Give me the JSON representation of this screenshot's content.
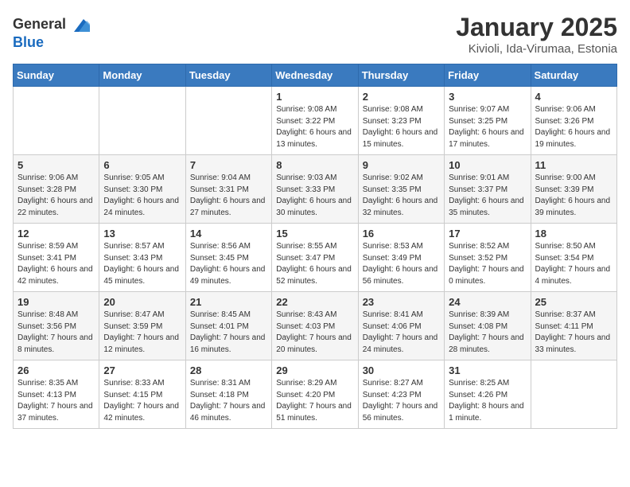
{
  "header": {
    "logo_general": "General",
    "logo_blue": "Blue",
    "title": "January 2025",
    "subtitle": "Kivioli, Ida-Virumaa, Estonia"
  },
  "weekdays": [
    "Sunday",
    "Monday",
    "Tuesday",
    "Wednesday",
    "Thursday",
    "Friday",
    "Saturday"
  ],
  "weeks": [
    [
      {
        "day": "",
        "sunrise": "",
        "sunset": "",
        "daylight": ""
      },
      {
        "day": "",
        "sunrise": "",
        "sunset": "",
        "daylight": ""
      },
      {
        "day": "",
        "sunrise": "",
        "sunset": "",
        "daylight": ""
      },
      {
        "day": "1",
        "sunrise": "Sunrise: 9:08 AM",
        "sunset": "Sunset: 3:22 PM",
        "daylight": "Daylight: 6 hours and 13 minutes."
      },
      {
        "day": "2",
        "sunrise": "Sunrise: 9:08 AM",
        "sunset": "Sunset: 3:23 PM",
        "daylight": "Daylight: 6 hours and 15 minutes."
      },
      {
        "day": "3",
        "sunrise": "Sunrise: 9:07 AM",
        "sunset": "Sunset: 3:25 PM",
        "daylight": "Daylight: 6 hours and 17 minutes."
      },
      {
        "day": "4",
        "sunrise": "Sunrise: 9:06 AM",
        "sunset": "Sunset: 3:26 PM",
        "daylight": "Daylight: 6 hours and 19 minutes."
      }
    ],
    [
      {
        "day": "5",
        "sunrise": "Sunrise: 9:06 AM",
        "sunset": "Sunset: 3:28 PM",
        "daylight": "Daylight: 6 hours and 22 minutes."
      },
      {
        "day": "6",
        "sunrise": "Sunrise: 9:05 AM",
        "sunset": "Sunset: 3:30 PM",
        "daylight": "Daylight: 6 hours and 24 minutes."
      },
      {
        "day": "7",
        "sunrise": "Sunrise: 9:04 AM",
        "sunset": "Sunset: 3:31 PM",
        "daylight": "Daylight: 6 hours and 27 minutes."
      },
      {
        "day": "8",
        "sunrise": "Sunrise: 9:03 AM",
        "sunset": "Sunset: 3:33 PM",
        "daylight": "Daylight: 6 hours and 30 minutes."
      },
      {
        "day": "9",
        "sunrise": "Sunrise: 9:02 AM",
        "sunset": "Sunset: 3:35 PM",
        "daylight": "Daylight: 6 hours and 32 minutes."
      },
      {
        "day": "10",
        "sunrise": "Sunrise: 9:01 AM",
        "sunset": "Sunset: 3:37 PM",
        "daylight": "Daylight: 6 hours and 35 minutes."
      },
      {
        "day": "11",
        "sunrise": "Sunrise: 9:00 AM",
        "sunset": "Sunset: 3:39 PM",
        "daylight": "Daylight: 6 hours and 39 minutes."
      }
    ],
    [
      {
        "day": "12",
        "sunrise": "Sunrise: 8:59 AM",
        "sunset": "Sunset: 3:41 PM",
        "daylight": "Daylight: 6 hours and 42 minutes."
      },
      {
        "day": "13",
        "sunrise": "Sunrise: 8:57 AM",
        "sunset": "Sunset: 3:43 PM",
        "daylight": "Daylight: 6 hours and 45 minutes."
      },
      {
        "day": "14",
        "sunrise": "Sunrise: 8:56 AM",
        "sunset": "Sunset: 3:45 PM",
        "daylight": "Daylight: 6 hours and 49 minutes."
      },
      {
        "day": "15",
        "sunrise": "Sunrise: 8:55 AM",
        "sunset": "Sunset: 3:47 PM",
        "daylight": "Daylight: 6 hours and 52 minutes."
      },
      {
        "day": "16",
        "sunrise": "Sunrise: 8:53 AM",
        "sunset": "Sunset: 3:49 PM",
        "daylight": "Daylight: 6 hours and 56 minutes."
      },
      {
        "day": "17",
        "sunrise": "Sunrise: 8:52 AM",
        "sunset": "Sunset: 3:52 PM",
        "daylight": "Daylight: 7 hours and 0 minutes."
      },
      {
        "day": "18",
        "sunrise": "Sunrise: 8:50 AM",
        "sunset": "Sunset: 3:54 PM",
        "daylight": "Daylight: 7 hours and 4 minutes."
      }
    ],
    [
      {
        "day": "19",
        "sunrise": "Sunrise: 8:48 AM",
        "sunset": "Sunset: 3:56 PM",
        "daylight": "Daylight: 7 hours and 8 minutes."
      },
      {
        "day": "20",
        "sunrise": "Sunrise: 8:47 AM",
        "sunset": "Sunset: 3:59 PM",
        "daylight": "Daylight: 7 hours and 12 minutes."
      },
      {
        "day": "21",
        "sunrise": "Sunrise: 8:45 AM",
        "sunset": "Sunset: 4:01 PM",
        "daylight": "Daylight: 7 hours and 16 minutes."
      },
      {
        "day": "22",
        "sunrise": "Sunrise: 8:43 AM",
        "sunset": "Sunset: 4:03 PM",
        "daylight": "Daylight: 7 hours and 20 minutes."
      },
      {
        "day": "23",
        "sunrise": "Sunrise: 8:41 AM",
        "sunset": "Sunset: 4:06 PM",
        "daylight": "Daylight: 7 hours and 24 minutes."
      },
      {
        "day": "24",
        "sunrise": "Sunrise: 8:39 AM",
        "sunset": "Sunset: 4:08 PM",
        "daylight": "Daylight: 7 hours and 28 minutes."
      },
      {
        "day": "25",
        "sunrise": "Sunrise: 8:37 AM",
        "sunset": "Sunset: 4:11 PM",
        "daylight": "Daylight: 7 hours and 33 minutes."
      }
    ],
    [
      {
        "day": "26",
        "sunrise": "Sunrise: 8:35 AM",
        "sunset": "Sunset: 4:13 PM",
        "daylight": "Daylight: 7 hours and 37 minutes."
      },
      {
        "day": "27",
        "sunrise": "Sunrise: 8:33 AM",
        "sunset": "Sunset: 4:15 PM",
        "daylight": "Daylight: 7 hours and 42 minutes."
      },
      {
        "day": "28",
        "sunrise": "Sunrise: 8:31 AM",
        "sunset": "Sunset: 4:18 PM",
        "daylight": "Daylight: 7 hours and 46 minutes."
      },
      {
        "day": "29",
        "sunrise": "Sunrise: 8:29 AM",
        "sunset": "Sunset: 4:20 PM",
        "daylight": "Daylight: 7 hours and 51 minutes."
      },
      {
        "day": "30",
        "sunrise": "Sunrise: 8:27 AM",
        "sunset": "Sunset: 4:23 PM",
        "daylight": "Daylight: 7 hours and 56 minutes."
      },
      {
        "day": "31",
        "sunrise": "Sunrise: 8:25 AM",
        "sunset": "Sunset: 4:26 PM",
        "daylight": "Daylight: 8 hours and 1 minute."
      },
      {
        "day": "",
        "sunrise": "",
        "sunset": "",
        "daylight": ""
      }
    ]
  ]
}
